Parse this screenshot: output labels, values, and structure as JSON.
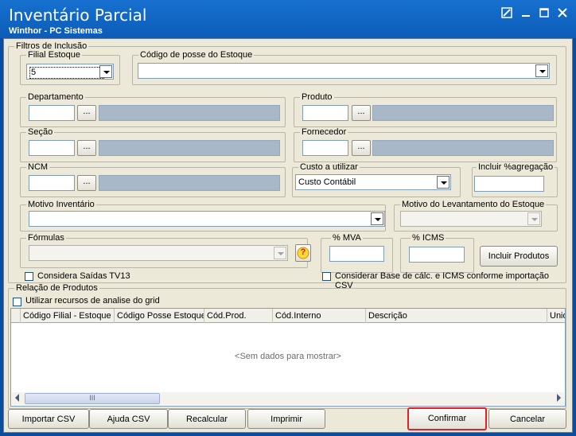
{
  "window": {
    "title": "Inventário Parcial",
    "subtitle": "Winthor - PC Sistemas"
  },
  "filters": {
    "legend": "Filtros de Inclusão",
    "filial": {
      "label": "Filial Estoque",
      "value": "5"
    },
    "codigo_posse": {
      "label": "Código de posse do Estoque",
      "value": ""
    },
    "departamento": {
      "label": "Departamento",
      "button": "..."
    },
    "produto": {
      "label": "Produto",
      "button": "..."
    },
    "secao": {
      "label": "Seção",
      "button": "..."
    },
    "fornecedor": {
      "label": "Fornecedor",
      "button": "..."
    },
    "ncm": {
      "label": "NCM",
      "button": "..."
    },
    "custo": {
      "label": "Custo a utilizar",
      "value": "Custo Contábil"
    },
    "agregacao": {
      "label": "Incluir %agregação"
    },
    "motivo_inventario": {
      "label": "Motivo Inventário",
      "value": ""
    },
    "motivo_levantamento": {
      "label": "Motivo do Levantamento do Estoque",
      "value": ""
    },
    "formulas": {
      "label": "Fórmulas",
      "help_icon": "?"
    },
    "mva": {
      "label": "% MVA"
    },
    "icms": {
      "label": "% ICMS"
    },
    "incluir_produtos": "Incluir Produtos",
    "considera_saidas": "Considera Saídas TV13",
    "considerar_base": "Considerar Base de cálc. e ICMS conforme importação CSV"
  },
  "relacao": {
    "legend": "Relação de Produtos",
    "utilizar": "Utilizar recursos de analise do grid",
    "columns": [
      "Código Filial - Estoque",
      "Código Posse Estoque",
      "Cód.Prod.",
      "Cód.Interno",
      "Descrição",
      "Unid"
    ],
    "empty": "<Sem dados para mostrar>",
    "scroll_grip": "III"
  },
  "actions": {
    "importar": "Importar CSV",
    "ajuda": "Ajuda CSV",
    "recalcular": "Recalcular",
    "imprimir": "Imprimir",
    "confirmar": "Confirmar",
    "cancelar": "Cancelar"
  },
  "colors": {
    "title_bar": "#0c5cb8",
    "highlight": "#e0202a"
  }
}
